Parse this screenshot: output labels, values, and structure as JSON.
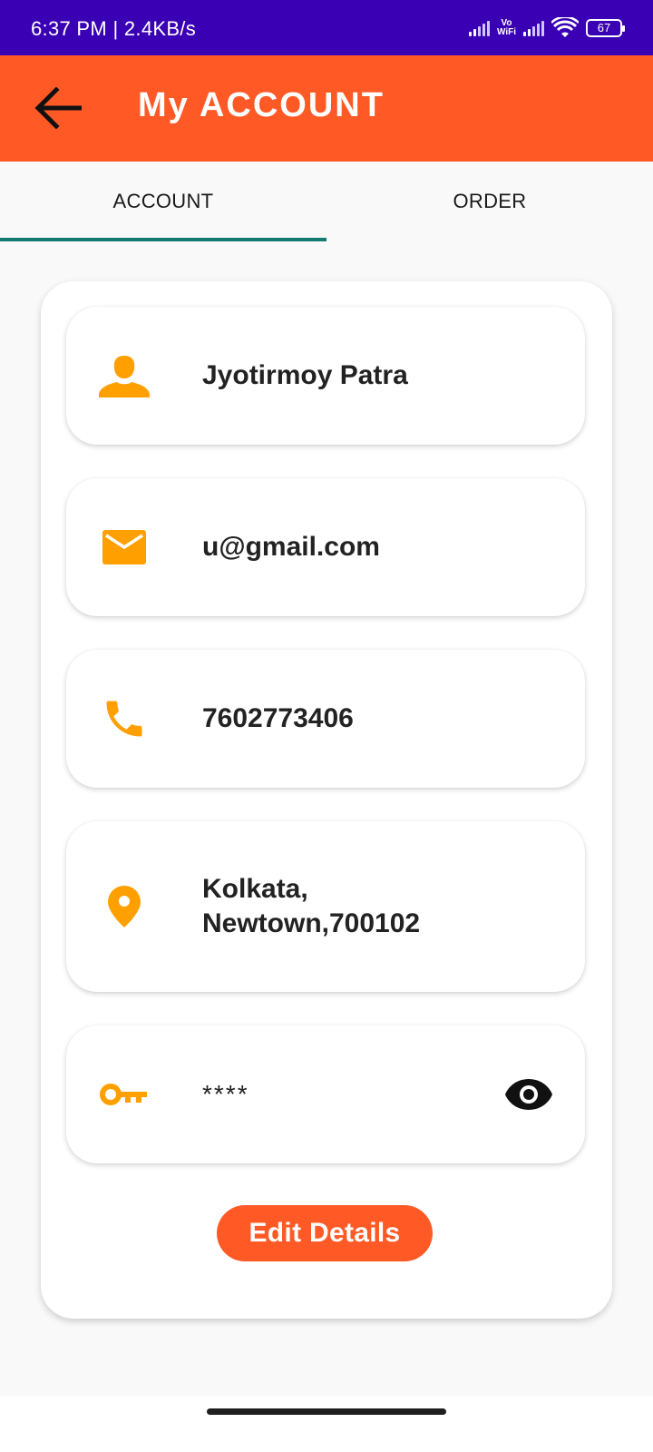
{
  "status_bar": {
    "time_speed": "6:37 PM | 2.4KB/s",
    "vowifi_top": "Vo",
    "vowifi_bottom": "WiFi",
    "battery": "67"
  },
  "app_bar": {
    "title": "My ACCOUNT",
    "back_icon": "arrow-back-icon"
  },
  "tabs": [
    {
      "label": "ACCOUNT",
      "active": true
    },
    {
      "label": "ORDER",
      "active": false
    }
  ],
  "account": {
    "name": {
      "icon": "person-icon",
      "value": "Jyotirmoy Patra"
    },
    "email": {
      "icon": "mail-icon",
      "value": "u@gmail.com"
    },
    "phone": {
      "icon": "phone-icon",
      "value": "7602773406"
    },
    "address": {
      "icon": "location-pin-icon",
      "value": "Kolkata,\nNewtown,700102"
    },
    "password": {
      "icon": "key-icon",
      "value": "****",
      "toggle_icon": "eye-icon"
    }
  },
  "edit_button_label": "Edit Details",
  "colors": {
    "status_bar": "#3a00b3",
    "accent": "#ff5a26",
    "icon": "#ff9f00",
    "tab_indicator": "#137a72"
  }
}
